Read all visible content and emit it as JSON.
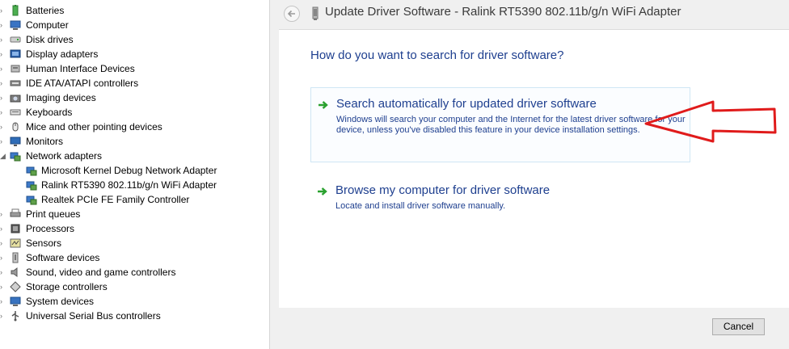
{
  "tree": {
    "items": [
      {
        "label": "Batteries",
        "icon": "battery-icon",
        "expander": "›"
      },
      {
        "label": "Computer",
        "icon": "computer-icon",
        "expander": "›"
      },
      {
        "label": "Disk drives",
        "icon": "disk-drive-icon",
        "expander": "›"
      },
      {
        "label": "Display adapters",
        "icon": "display-adapter-icon",
        "expander": "›"
      },
      {
        "label": "Human Interface Devices",
        "icon": "hid-icon",
        "expander": "›"
      },
      {
        "label": "IDE ATA/ATAPI controllers",
        "icon": "ide-controller-icon",
        "expander": "›"
      },
      {
        "label": "Imaging devices",
        "icon": "camera-icon",
        "expander": "›"
      },
      {
        "label": "Keyboards",
        "icon": "keyboard-icon",
        "expander": "›"
      },
      {
        "label": "Mice and other pointing devices",
        "icon": "mouse-icon",
        "expander": "›"
      },
      {
        "label": "Monitors",
        "icon": "monitor-icon",
        "expander": "›"
      },
      {
        "label": "Network adapters",
        "icon": "network-adapter-icon",
        "expander": "◢"
      },
      {
        "label": "Microsoft Kernel Debug Network Adapter",
        "icon": "network-adapter-icon",
        "expander": ""
      },
      {
        "label": "Ralink RT5390 802.11b/g/n WiFi Adapter",
        "icon": "network-adapter-icon",
        "expander": ""
      },
      {
        "label": "Realtek PCIe FE Family Controller",
        "icon": "network-adapter-icon",
        "expander": ""
      },
      {
        "label": "Print queues",
        "icon": "printer-icon",
        "expander": "›"
      },
      {
        "label": "Processors",
        "icon": "processor-icon",
        "expander": "›"
      },
      {
        "label": "Sensors",
        "icon": "sensor-icon",
        "expander": "›"
      },
      {
        "label": "Software devices",
        "icon": "software-device-icon",
        "expander": "›"
      },
      {
        "label": "Sound, video and game controllers",
        "icon": "speaker-icon",
        "expander": "›"
      },
      {
        "label": "Storage controllers",
        "icon": "storage-controller-icon",
        "expander": "›"
      },
      {
        "label": "System devices",
        "icon": "system-device-icon",
        "expander": "›"
      },
      {
        "label": "Universal Serial Bus controllers",
        "icon": "usb-icon",
        "expander": "›"
      }
    ]
  },
  "dialog": {
    "title": "Update Driver Software - Ralink RT5390 802.11b/g/n WiFi Adapter",
    "question": "How do you want to search for driver software?",
    "options": [
      {
        "title": "Search automatically for updated driver software",
        "description": "Windows will search your computer and the Internet for the latest driver software for your device, unless you've disabled this feature in your device installation settings."
      },
      {
        "title": "Browse my computer for driver software",
        "description": "Locate and install driver software manually."
      }
    ],
    "cancel_label": "Cancel"
  },
  "colors": {
    "heading_blue": "#1e3f8f",
    "option_arrow_green": "#2aa12f",
    "annotation_red": "#e01b1b"
  }
}
